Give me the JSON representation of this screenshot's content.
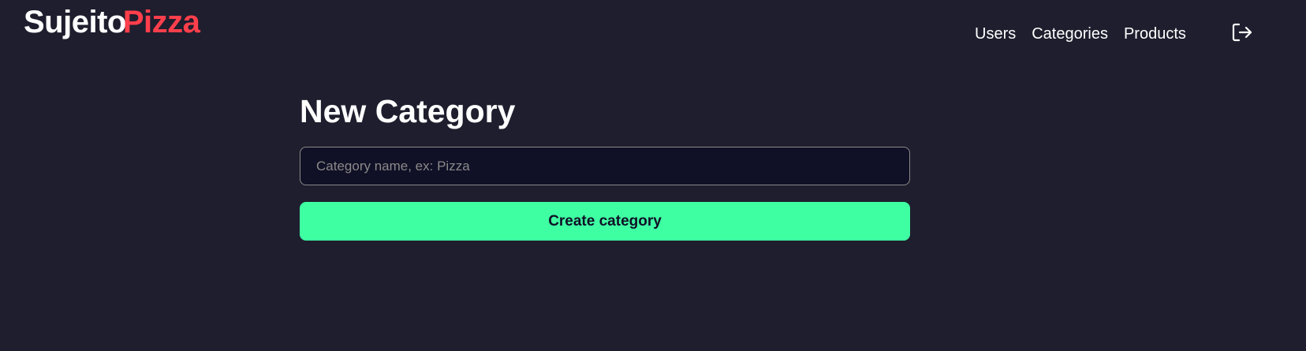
{
  "brand": {
    "part1": "Sujeito",
    "part2": "Pizza"
  },
  "nav": {
    "items": [
      {
        "label": "Users"
      },
      {
        "label": "Categories"
      },
      {
        "label": "Products"
      }
    ],
    "logout_icon": "logout-icon"
  },
  "form": {
    "title": "New Category",
    "name_input": {
      "placeholder": "Category name, ex: Pizza",
      "value": ""
    },
    "submit_label": "Create category"
  },
  "colors": {
    "background": "#1e1e2e",
    "brand_accent": "#ff3f4b",
    "input_background": "#101026",
    "button": "#3fffa3"
  }
}
